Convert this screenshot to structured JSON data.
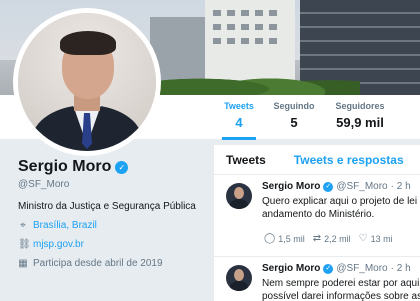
{
  "profile": {
    "name": "Sergio Moro",
    "handle": "@SF_Moro",
    "bio": "Ministro da Justiça e Segurança Pública",
    "location": "Brasília, Brazil",
    "website": "mjsp.gov.br",
    "joined": "Participa desde abril de 2019"
  },
  "stats": [
    {
      "label": "Tweets",
      "value": "4"
    },
    {
      "label": "Seguindo",
      "value": "5"
    },
    {
      "label": "Seguidores",
      "value": "59,9 mil"
    }
  ],
  "tabs": {
    "tweets": "Tweets",
    "replies": "Tweets e respostas"
  },
  "tweets": [
    {
      "name": "Sergio Moro",
      "handle": "@SF_Moro",
      "time": "· 2 h",
      "lines": [
        "Quero explicar aqui o projeto de lei a",
        "andamento do Ministério."
      ],
      "replies": "1,5 mil",
      "retweets": "2,2 mil",
      "likes": "13 mi"
    },
    {
      "name": "Sergio Moro",
      "handle": "@SF_Moro",
      "time": "· 2 h",
      "lines": [
        "Nem sempre poderei estar por aqui,",
        "possível darei informações sobre as a"
      ]
    }
  ],
  "icons": {
    "verified": "verified-badge-icon",
    "location": "location-pin-icon",
    "link": "link-icon",
    "calendar": "calendar-icon",
    "reply": "reply-icon",
    "retweet": "retweet-icon",
    "like": "heart-icon"
  },
  "colors": {
    "accent": "#1da1f2",
    "muted": "#657786",
    "text": "#14171a"
  }
}
